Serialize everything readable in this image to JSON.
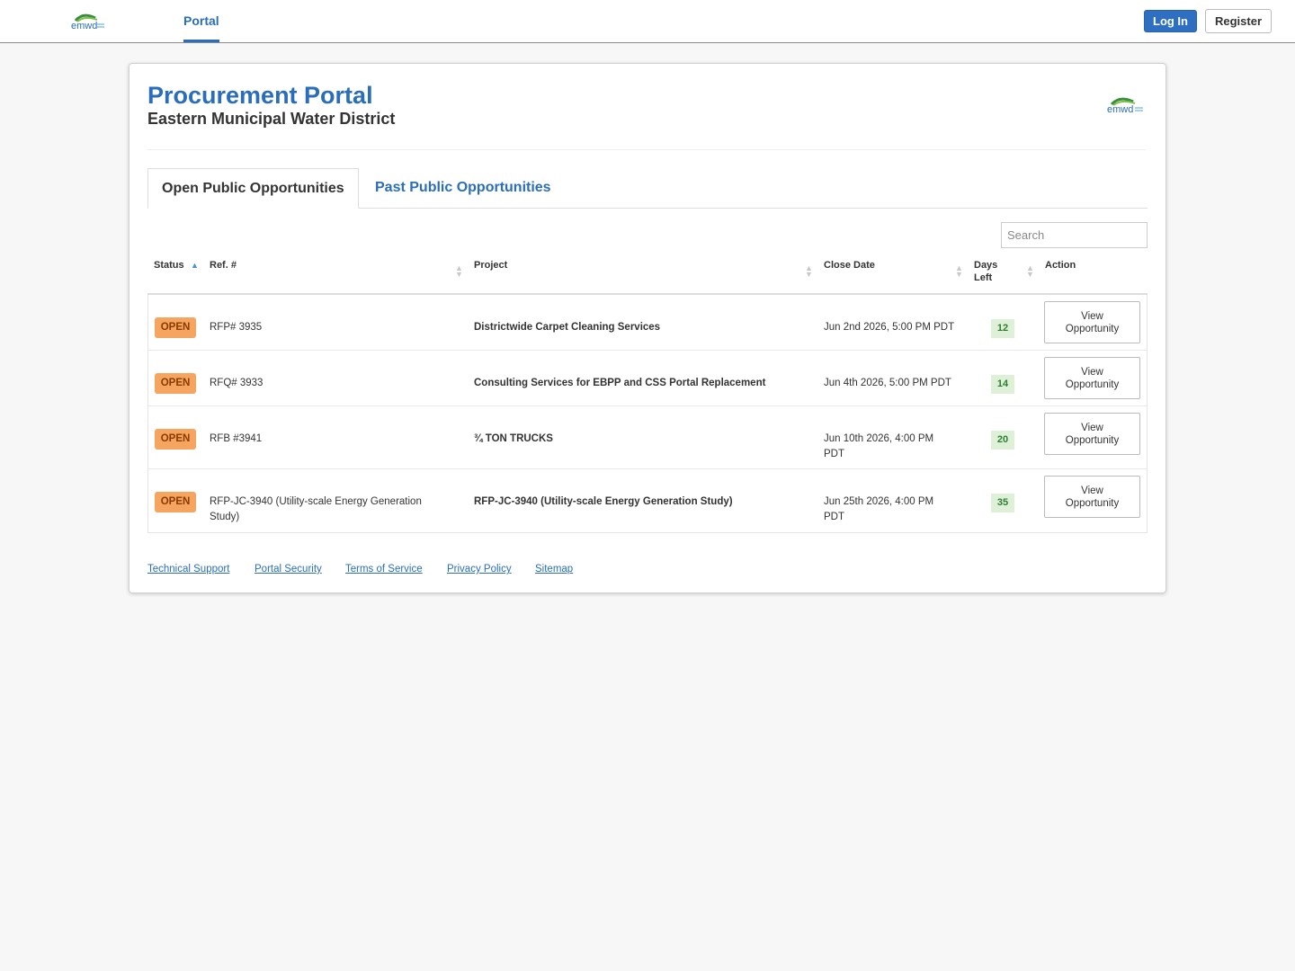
{
  "nav": {
    "logo_text": "emwd",
    "portal_tab": "Portal",
    "login_label": "Log In",
    "register_label": "Register"
  },
  "header": {
    "title": "Procurement Portal",
    "subtitle": "Eastern Municipal Water District"
  },
  "tabs": {
    "open": "Open Public Opportunities",
    "past": "Past Public Opportunities"
  },
  "search": {
    "placeholder": "Search"
  },
  "table": {
    "columns": {
      "status": "Status",
      "ref": "Ref. #",
      "project": "Project",
      "close_date": "Close Date",
      "days_left_line1": "Days",
      "days_left_line2": "Left",
      "action": "Action"
    },
    "rows": [
      {
        "status": "OPEN",
        "ref": "RFP# 3935",
        "ref_line2": "",
        "project": "Districtwide Carpet Cleaning Services",
        "close_line1": "Jun 2nd 2026, 5:00 PM PDT",
        "close_line2": "",
        "days_left": "12",
        "action_line1": "View",
        "action_line2": "Opportunity"
      },
      {
        "status": "OPEN",
        "ref": "RFQ# 3933",
        "ref_line2": "",
        "project": "Consulting Services for EBPP and CSS Portal Replacement",
        "close_line1": "Jun 4th 2026, 5:00 PM PDT",
        "close_line2": "",
        "days_left": "14",
        "action_line1": "View",
        "action_line2": "Opportunity"
      },
      {
        "status": "OPEN",
        "ref": "RFB #3941",
        "ref_line2": "",
        "project": "¾ TON TRUCKS",
        "close_line1": "Jun 10th 2026, 4:00 PM",
        "close_line2": "PDT",
        "days_left": "20",
        "action_line1": "View",
        "action_line2": "Opportunity"
      },
      {
        "status": "OPEN",
        "ref": "RFP-JC-3940 (Utility-scale Energy Generation",
        "ref_line2": "Study)",
        "project": "RFP-JC-3940 (Utility-scale Energy Generation Study)",
        "close_line1": "Jun 25th 2026, 4:00 PM",
        "close_line2": "PDT",
        "days_left": "35",
        "action_line1": "View",
        "action_line2": "Opportunity"
      }
    ]
  },
  "footer": {
    "links": [
      "Technical Support",
      "Portal Security",
      "Terms of Service",
      "Privacy Policy",
      "Sitemap"
    ]
  },
  "colors": {
    "brand_blue": "#2a6ebb",
    "open_badge": "#f5a55f",
    "days_badge": "#dff0d8"
  }
}
